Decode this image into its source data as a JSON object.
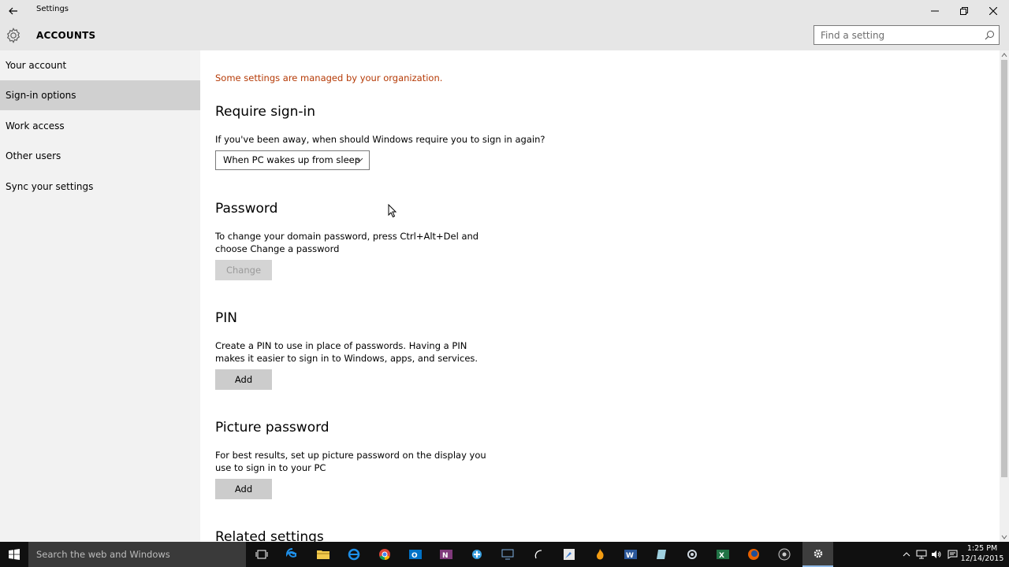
{
  "window": {
    "title": "Settings",
    "section": "ACCOUNTS"
  },
  "search": {
    "placeholder": "Find a setting"
  },
  "sidebar": {
    "items": [
      {
        "label": "Your account"
      },
      {
        "label": "Sign-in options",
        "active": true
      },
      {
        "label": "Work access"
      },
      {
        "label": "Other users"
      },
      {
        "label": "Sync your settings"
      }
    ]
  },
  "main": {
    "notice": "Some settings are managed by your organization.",
    "require_signin": {
      "heading": "Require sign-in",
      "question": "If you've been away, when should Windows require you to sign in again?",
      "selected": "When PC wakes up from sleep"
    },
    "password": {
      "heading": "Password",
      "description": "To change your domain password, press Ctrl+Alt+Del and choose Change a password",
      "button": "Change"
    },
    "pin": {
      "heading": "PIN",
      "description": "Create a PIN to use in place of passwords. Having a PIN makes it easier to sign in to Windows, apps, and services.",
      "button": "Add"
    },
    "picture_password": {
      "heading": "Picture password",
      "description": "For best results, set up picture password on the display you use to sign in to your PC",
      "button": "Add"
    },
    "related": {
      "heading": "Related settings"
    }
  },
  "taskbar": {
    "search_placeholder": "Search the web and Windows",
    "apps": [
      "task-view",
      "edge",
      "file-explorer",
      "chrome",
      "outlook",
      "onenote",
      "app-blue",
      "app-remote",
      "app-curve",
      "paint",
      "firefox-dev",
      "word",
      "app-tablet",
      "app-gear2",
      "excel",
      "firefox",
      "obs",
      "settings"
    ],
    "time": "1:25 PM",
    "date": "12/14/2015"
  },
  "colors": {
    "notice": "#b53a06",
    "chrome_bg": "#e6e6e6",
    "sidebar_bg": "#f2f2f2",
    "sidebar_active": "#d0d0d0",
    "taskbar_bg": "#101010"
  }
}
